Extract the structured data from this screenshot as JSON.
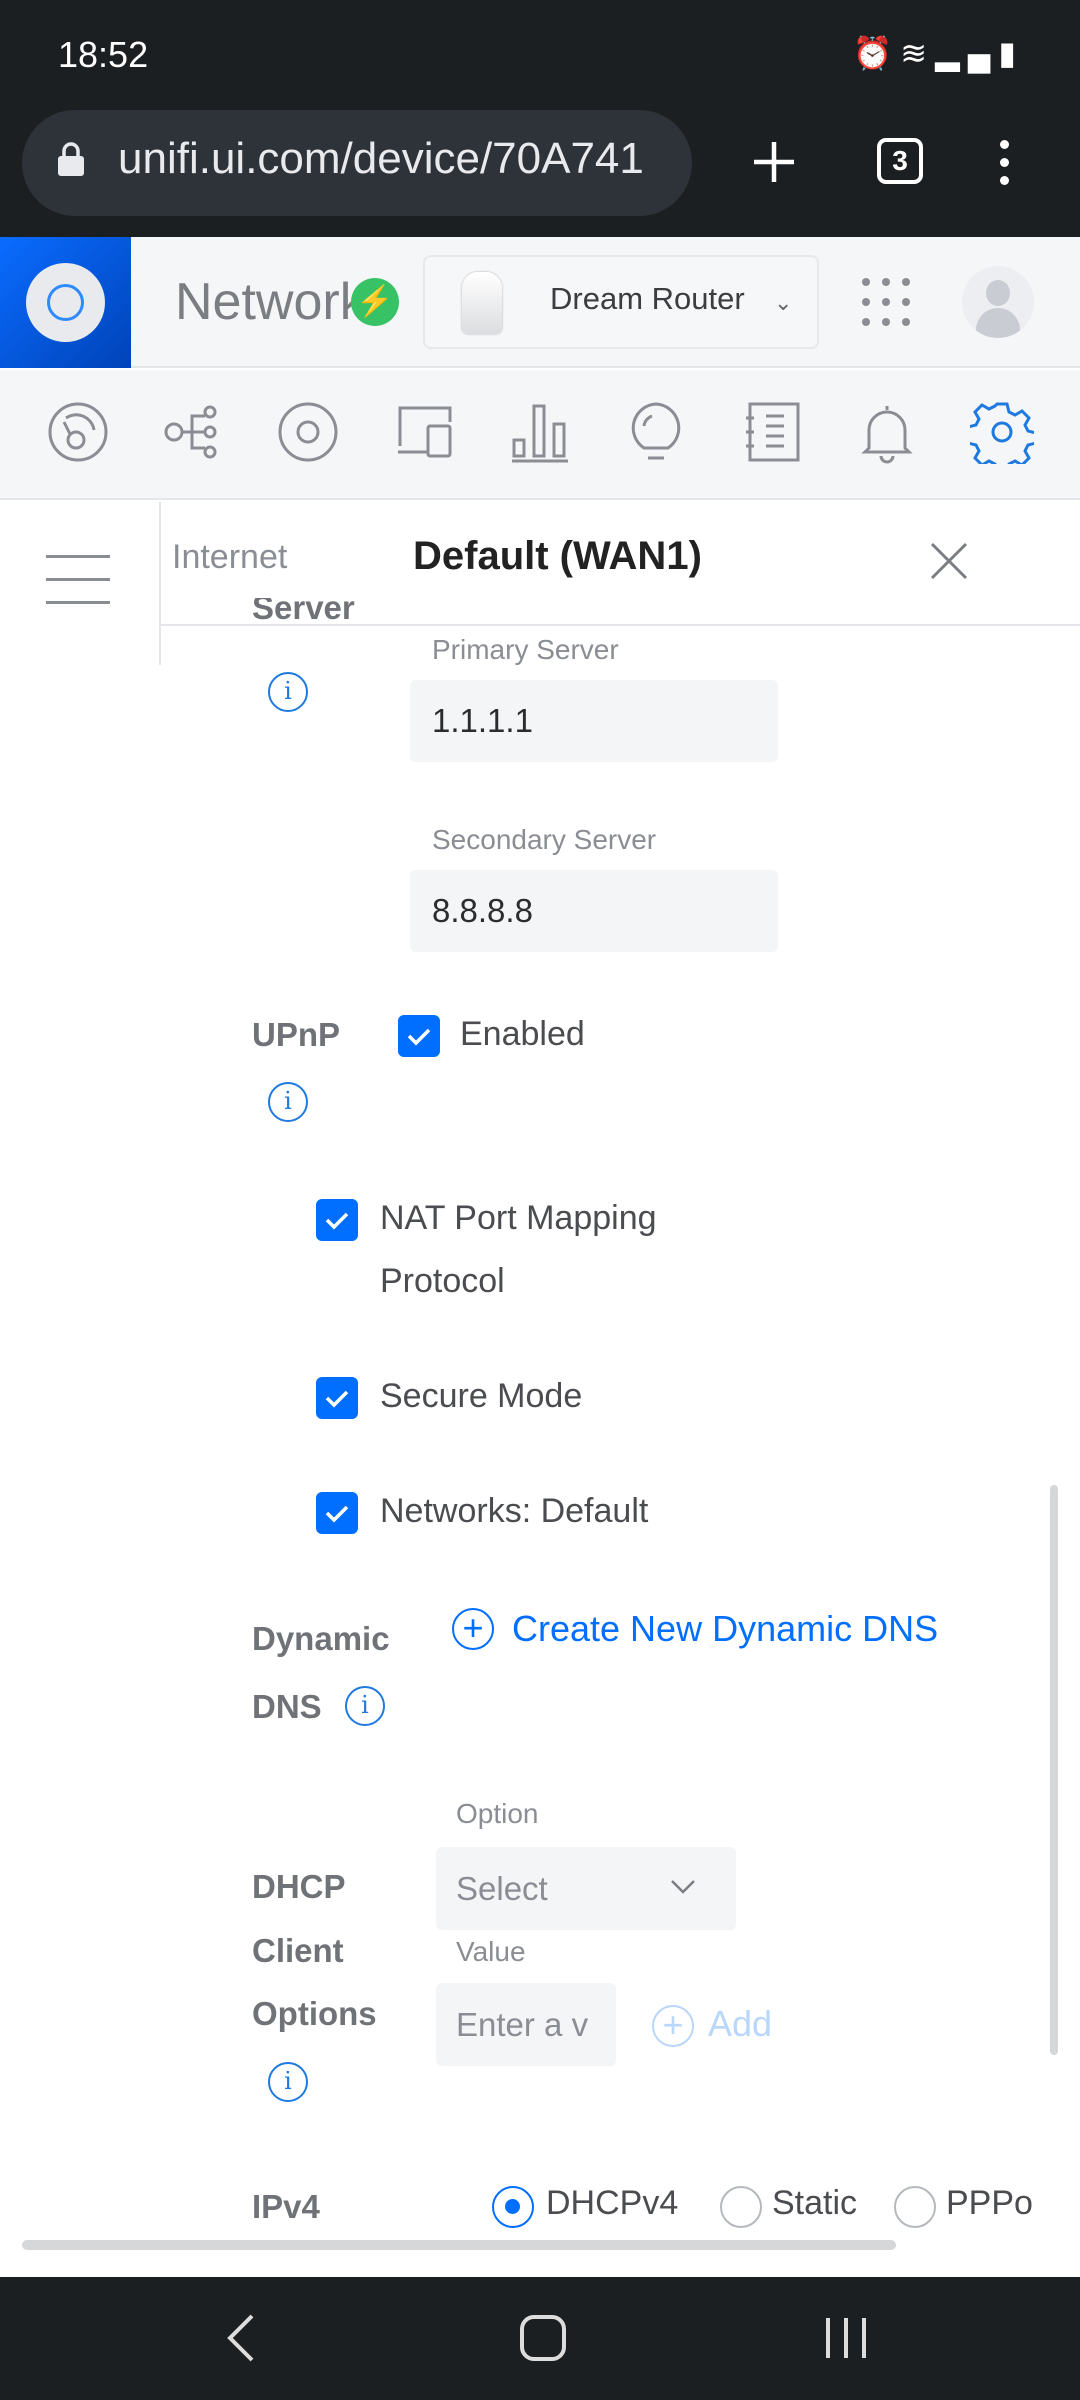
{
  "status_bar": {
    "time": "18:52",
    "icons": [
      "alarm-icon",
      "wifi-icon",
      "signal-icon",
      "battery-icon"
    ]
  },
  "browser": {
    "url": "unifi.ui.com/device/70A741",
    "tab_count": "3"
  },
  "app": {
    "name": "Network",
    "device": "Dream Router",
    "accent": "#006fff"
  },
  "icon_nav": [
    "dashboard-icon",
    "topology-icon",
    "devices-icon",
    "clients-icon",
    "statistics-icon",
    "insights-icon",
    "logs-icon",
    "alerts-icon",
    "settings-icon"
  ],
  "panel": {
    "tab": "Internet",
    "title": "Default (WAN1)",
    "dns": {
      "label_partial": "Server",
      "primary_label": "Primary Server",
      "primary_value": "1.1.1.1",
      "secondary_label": "Secondary Server",
      "secondary_value": "8.8.8.8"
    },
    "upnp": {
      "label": "UPnP",
      "enabled_label": "Enabled",
      "enabled": true,
      "options": [
        {
          "label_line1": "NAT Port Mapping",
          "label_line2": "Protocol",
          "checked": true
        },
        {
          "label_line1": "Secure Mode",
          "checked": true
        },
        {
          "label_line1": "Networks: Default",
          "checked": true
        }
      ]
    },
    "dynamic_dns": {
      "label_line1": "Dynamic",
      "label_line2": "DNS",
      "create_label": "Create New Dynamic DNS"
    },
    "dhcp_client_options": {
      "label_line1": "DHCP",
      "label_line2": "Client",
      "label_line3": "Options",
      "option_label": "Option",
      "option_value": "Select",
      "value_label": "Value",
      "value_placeholder": "Enter a v",
      "add_label": "Add"
    },
    "ipv4": {
      "label": "IPv4",
      "options": [
        "DHCPv4",
        "Static",
        "PPPo"
      ],
      "selected": "DHCPv4"
    }
  }
}
